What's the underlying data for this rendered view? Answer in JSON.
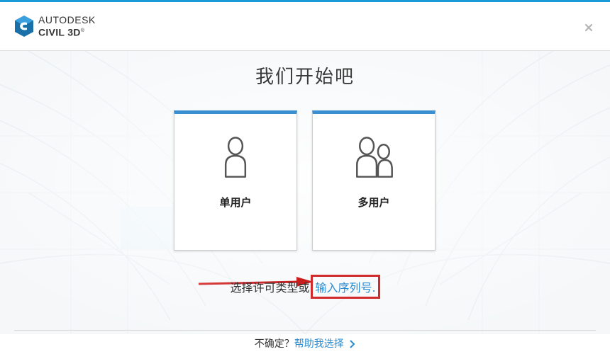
{
  "header": {
    "brand": "AUTODESK",
    "product": "CIVIL 3D",
    "trademark": "®"
  },
  "main": {
    "title": "我们开始吧",
    "cards": [
      {
        "label": "单用户",
        "icon": "single-user-icon"
      },
      {
        "label": "多用户",
        "icon": "multi-user-icon"
      }
    ],
    "license_prefix": "选择许可类型或",
    "serial_link": "输入序列号."
  },
  "footer": {
    "question": "不确定？",
    "help_link": "帮助我选择"
  },
  "colors": {
    "accent": "#3a8fd0",
    "link": "#2a8bd0",
    "highlight": "#d12a2a"
  }
}
